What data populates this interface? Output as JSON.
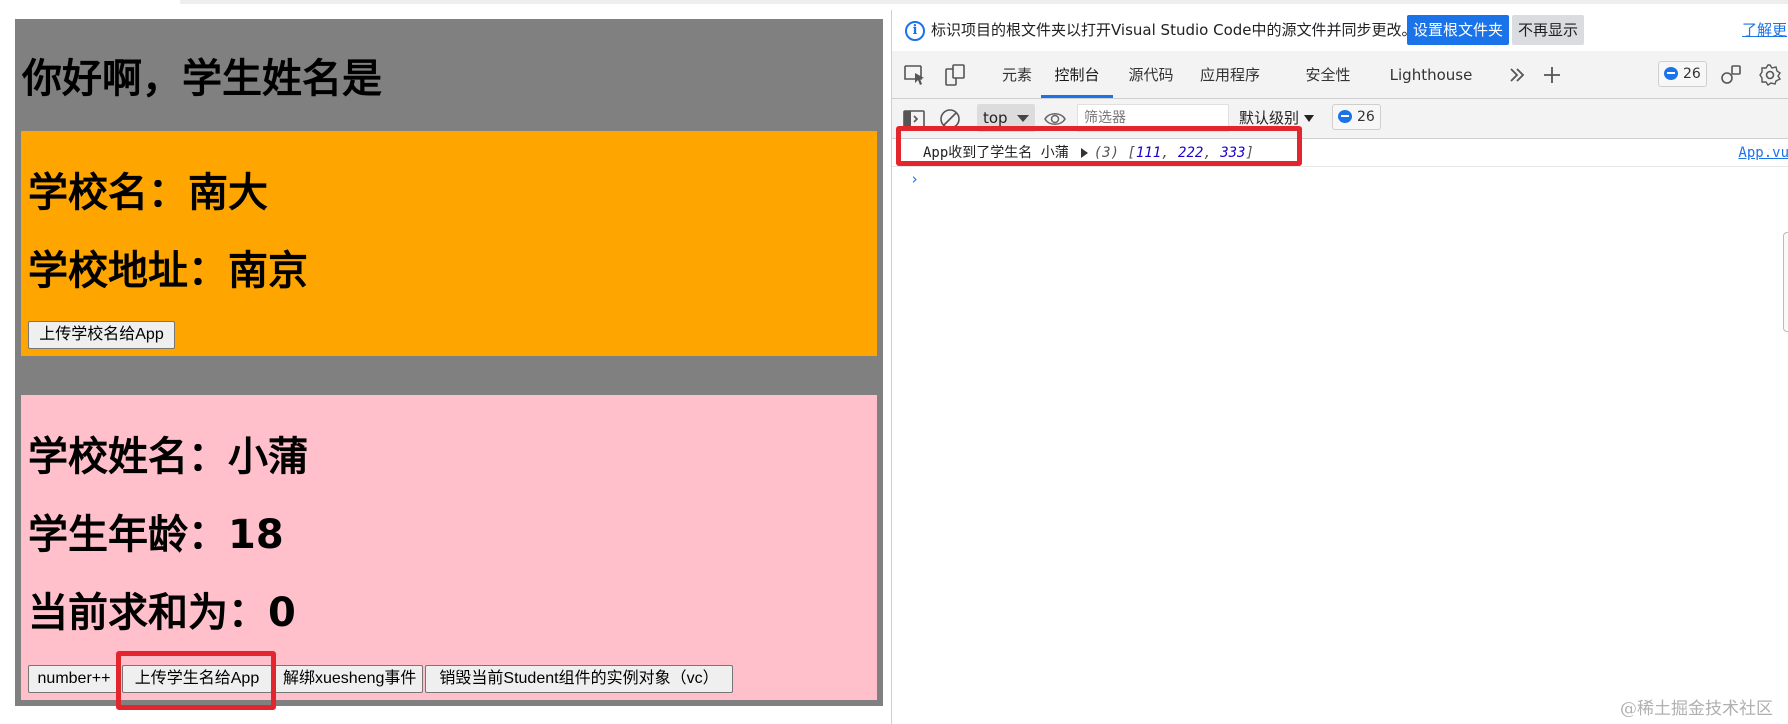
{
  "app": {
    "greeting": "你好啊，学生姓名是",
    "school": {
      "name_line": "学校名：南大",
      "address_line": "学校地址：南京",
      "upload_button": "上传学校名给App"
    },
    "student": {
      "name_line": "学校姓名：小蒲",
      "age_line": "学生年龄：18",
      "sum_line": "当前求和为：0",
      "buttons": {
        "increment": "number++",
        "upload": "上传学生名给App",
        "unbind": "解绑xuesheng事件",
        "destroy": "销毁当前Student组件的实例对象（vc）"
      }
    },
    "colors": {
      "page_bg": "#808080",
      "school_bg": "#ffa500",
      "student_bg": "#ffc0cb",
      "highlight": "#e3262e"
    }
  },
  "devtools": {
    "infobar": {
      "message": "标识项目的根文件夹以打开Visual Studio Code中的源文件并同步更改。",
      "set_root_button": "设置根文件夹",
      "dismiss_button": "不再显示",
      "learn_more_link": "了解更"
    },
    "tabs": [
      {
        "label": "元素",
        "active": false
      },
      {
        "label": "控制台",
        "active": true
      },
      {
        "label": "源代码",
        "active": false
      },
      {
        "label": "应用程序",
        "active": false
      },
      {
        "label": "安全性",
        "active": false
      },
      {
        "label": "Lighthouse",
        "active": false
      }
    ],
    "issues_count": "26",
    "console_toolbar": {
      "context": "top",
      "filter_placeholder": "筛选器",
      "level": "默认级别",
      "issues_count": "26"
    },
    "log": {
      "message": "App收到了学生名 小蒲",
      "array_length": "(3)",
      "array_values": [
        "111",
        "222",
        "333"
      ],
      "source": "App.vu"
    },
    "prompt_symbol": "›",
    "accent": "#1a73e8"
  },
  "watermark": "@稀土掘金技术社区"
}
